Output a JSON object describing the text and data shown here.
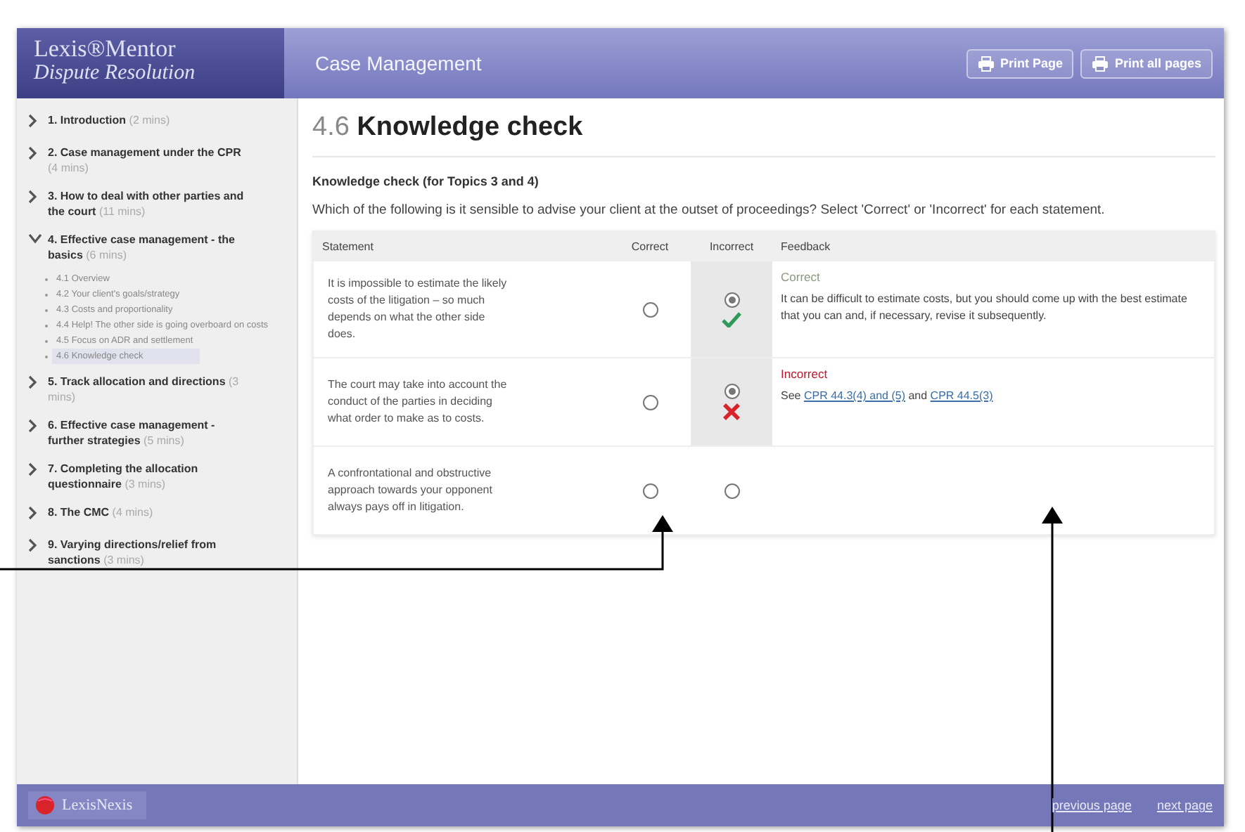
{
  "brand": {
    "name": "Lexis®Mentor",
    "subtitle": "Dispute Resolution"
  },
  "header": {
    "title": "Case Management",
    "buttons": [
      "Print Page",
      "Print all pages"
    ]
  },
  "sidebar": {
    "items": [
      {
        "label": "1. Introduction",
        "duration": "(2 mins)",
        "expanded": false
      },
      {
        "label": "2. Case management under the CPR",
        "duration": "(4 mins)",
        "expanded": false
      },
      {
        "label": "3. How to deal with other parties and the court",
        "duration": "(11 mins)",
        "expanded": false
      },
      {
        "label": "4. Effective case management - the basics",
        "duration": "(6 mins)",
        "expanded": true,
        "children": [
          {
            "label": "4.1 Overview",
            "selected": false
          },
          {
            "label": "4.2 Your client's goals/strategy",
            "selected": false
          },
          {
            "label": "4.3 Costs and proportionality",
            "selected": false
          },
          {
            "label": "4.4 Help! The other side is going overboard on costs",
            "selected": false
          },
          {
            "label": "4.5 Focus on ADR and settlement",
            "selected": false
          },
          {
            "label": "4.6 Knowledge check",
            "selected": true
          }
        ]
      },
      {
        "label": "5. Track allocation and directions",
        "duration": "(3 mins)",
        "expanded": false
      },
      {
        "label": "6. Effective case management - further strategies",
        "duration": "(5 mins)",
        "expanded": false
      },
      {
        "label": "7. Completing the allocation questionnaire",
        "duration": "(3 mins)",
        "expanded": false
      },
      {
        "label": "8. The CMC",
        "duration": "(4 mins)",
        "expanded": false
      },
      {
        "label": "9. Varying directions/relief from sanctions",
        "duration": "(3 mins)",
        "expanded": false
      }
    ]
  },
  "page": {
    "number": "4.6",
    "title": "Knowledge check",
    "subheading": "Knowledge check (for Topics 3 and 4)",
    "question": "Which of the following is it sensible to advise your client at the outset of proceedings? Select 'Correct' or 'Incorrect' for each statement."
  },
  "table": {
    "columns": [
      "Statement",
      "Correct",
      "Incorrect",
      "Feedback"
    ],
    "rows": [
      {
        "statement": "It is impossible to estimate the likely costs of the litigation – so much depends on what the other side does.",
        "correct_selected": false,
        "incorrect_selected": true,
        "answered": true,
        "answer_correct": true,
        "result_label": "Correct",
        "feedback": [
          {
            "kind": "text",
            "text": "It can be difficult to estimate costs, but you should come up with the best estimate that you can and, if necessary, revise it subsequently."
          }
        ]
      },
      {
        "statement": "The court may take into account the conduct of the parties in deciding what order to make as to costs.",
        "correct_selected": false,
        "incorrect_selected": true,
        "answered": true,
        "answer_correct": false,
        "result_label": "Incorrect",
        "feedback": [
          {
            "kind": "text",
            "text": "See "
          },
          {
            "kind": "link",
            "text": "CPR 44.3(4) and (5)"
          },
          {
            "kind": "text",
            "text": " and "
          },
          {
            "kind": "link",
            "text": "CPR 44.5(3)"
          }
        ]
      },
      {
        "statement": "A confrontational and obstructive approach towards your opponent always pays off in litigation.",
        "correct_selected": false,
        "incorrect_selected": false,
        "answered": false
      }
    ]
  },
  "footer": {
    "logo": "LexisNexis",
    "prev": "previous page",
    "next": "next page"
  }
}
